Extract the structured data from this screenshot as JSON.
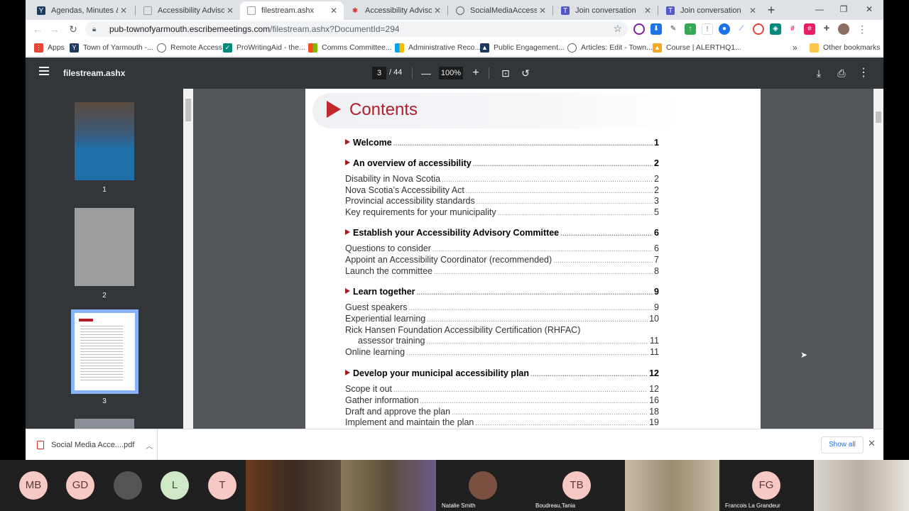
{
  "tabs": [
    {
      "title": "Agendas, Minutes & Livestream"
    },
    {
      "title": "Accessibility Advisory Committee"
    },
    {
      "title": "filestream.ashx"
    },
    {
      "title": "Accessibility Advisory Committee"
    },
    {
      "title": "SocialMediaAccessibility"
    },
    {
      "title": "Join conversation"
    },
    {
      "title": "Join conversation"
    }
  ],
  "address": {
    "host": "pub-townofyarmouth.escribemeetings.com",
    "path": "/filestream.ashx?DocumentId=294"
  },
  "bookmarks": [
    {
      "label": "Apps"
    },
    {
      "label": "Town of Yarmouth -..."
    },
    {
      "label": "Remote Access"
    },
    {
      "label": "ProWritingAid - the..."
    },
    {
      "label": "Comms Committee..."
    },
    {
      "label": "Administrative Reco..."
    },
    {
      "label": "Public Engagement..."
    },
    {
      "label": "Articles: Edit - Town..."
    },
    {
      "label": "Course | ALERTHQ1..."
    }
  ],
  "bookmarks_more": "»",
  "other_bookmarks": "Other bookmarks",
  "pdf": {
    "filename": "filestream.ashx",
    "current_page": "3",
    "total_pages": "/ 44",
    "zoom": "100%",
    "thumbnails": [
      "1",
      "2",
      "3"
    ]
  },
  "page": {
    "heading": "Contents",
    "toc": [
      {
        "label": "Welcome",
        "page": "1",
        "section": true
      },
      {
        "label": "An overview of accessibility",
        "page": "2",
        "section": true
      },
      {
        "label": "Disability in Nova Scotia",
        "page": "2"
      },
      {
        "label": "Nova Scotia’s Accessibility Act",
        "page": "2"
      },
      {
        "label": "Provincial accessibility standards",
        "page": "3"
      },
      {
        "label": "Key requirements for your municipality",
        "page": "5"
      },
      {
        "label": "Establish your Accessibility Advisory Committee",
        "page": "6",
        "section": true
      },
      {
        "label": "Questions to consider",
        "page": "6"
      },
      {
        "label": "Appoint an Accessibility Coordinator (recommended)",
        "page": "7"
      },
      {
        "label": "Launch the committee",
        "page": "8"
      },
      {
        "label": "Learn together",
        "page": "9",
        "section": true
      },
      {
        "label": "Guest speakers",
        "page": "9"
      },
      {
        "label": "Experiential learning",
        "page": "10"
      },
      {
        "label": "Rick Hansen Foundation Accessibility Certification (RHFAC)",
        "page": ""
      },
      {
        "label": "assessor training",
        "page": "11"
      },
      {
        "label": "Online learning",
        "page": "11"
      },
      {
        "label": "Develop your municipal accessibility plan",
        "page": "12",
        "section": true
      },
      {
        "label": "Scope it out",
        "page": "12"
      },
      {
        "label": "Gather information",
        "page": "16"
      },
      {
        "label": "Draft and approve the plan",
        "page": "18"
      },
      {
        "label": "Implement and maintain the plan",
        "page": "19"
      }
    ]
  },
  "download": {
    "filename": "Social Media Acce....pdf",
    "show_all": "Show all"
  },
  "participants": [
    {
      "initials": "MB"
    },
    {
      "initials": "GD"
    },
    {
      "initials": "L"
    },
    {
      "initials": "T"
    },
    {
      "initials": "TB",
      "name": "Boudreau,Tania"
    },
    {
      "initials": "FG",
      "name": "Francois La Grandeur"
    },
    {
      "name": "Natalie Smith"
    }
  ],
  "colors": {
    "accent_red": "#b01e2b",
    "avatar_pink": "#f6c9c5",
    "pdf_toolbar": "#323639"
  }
}
